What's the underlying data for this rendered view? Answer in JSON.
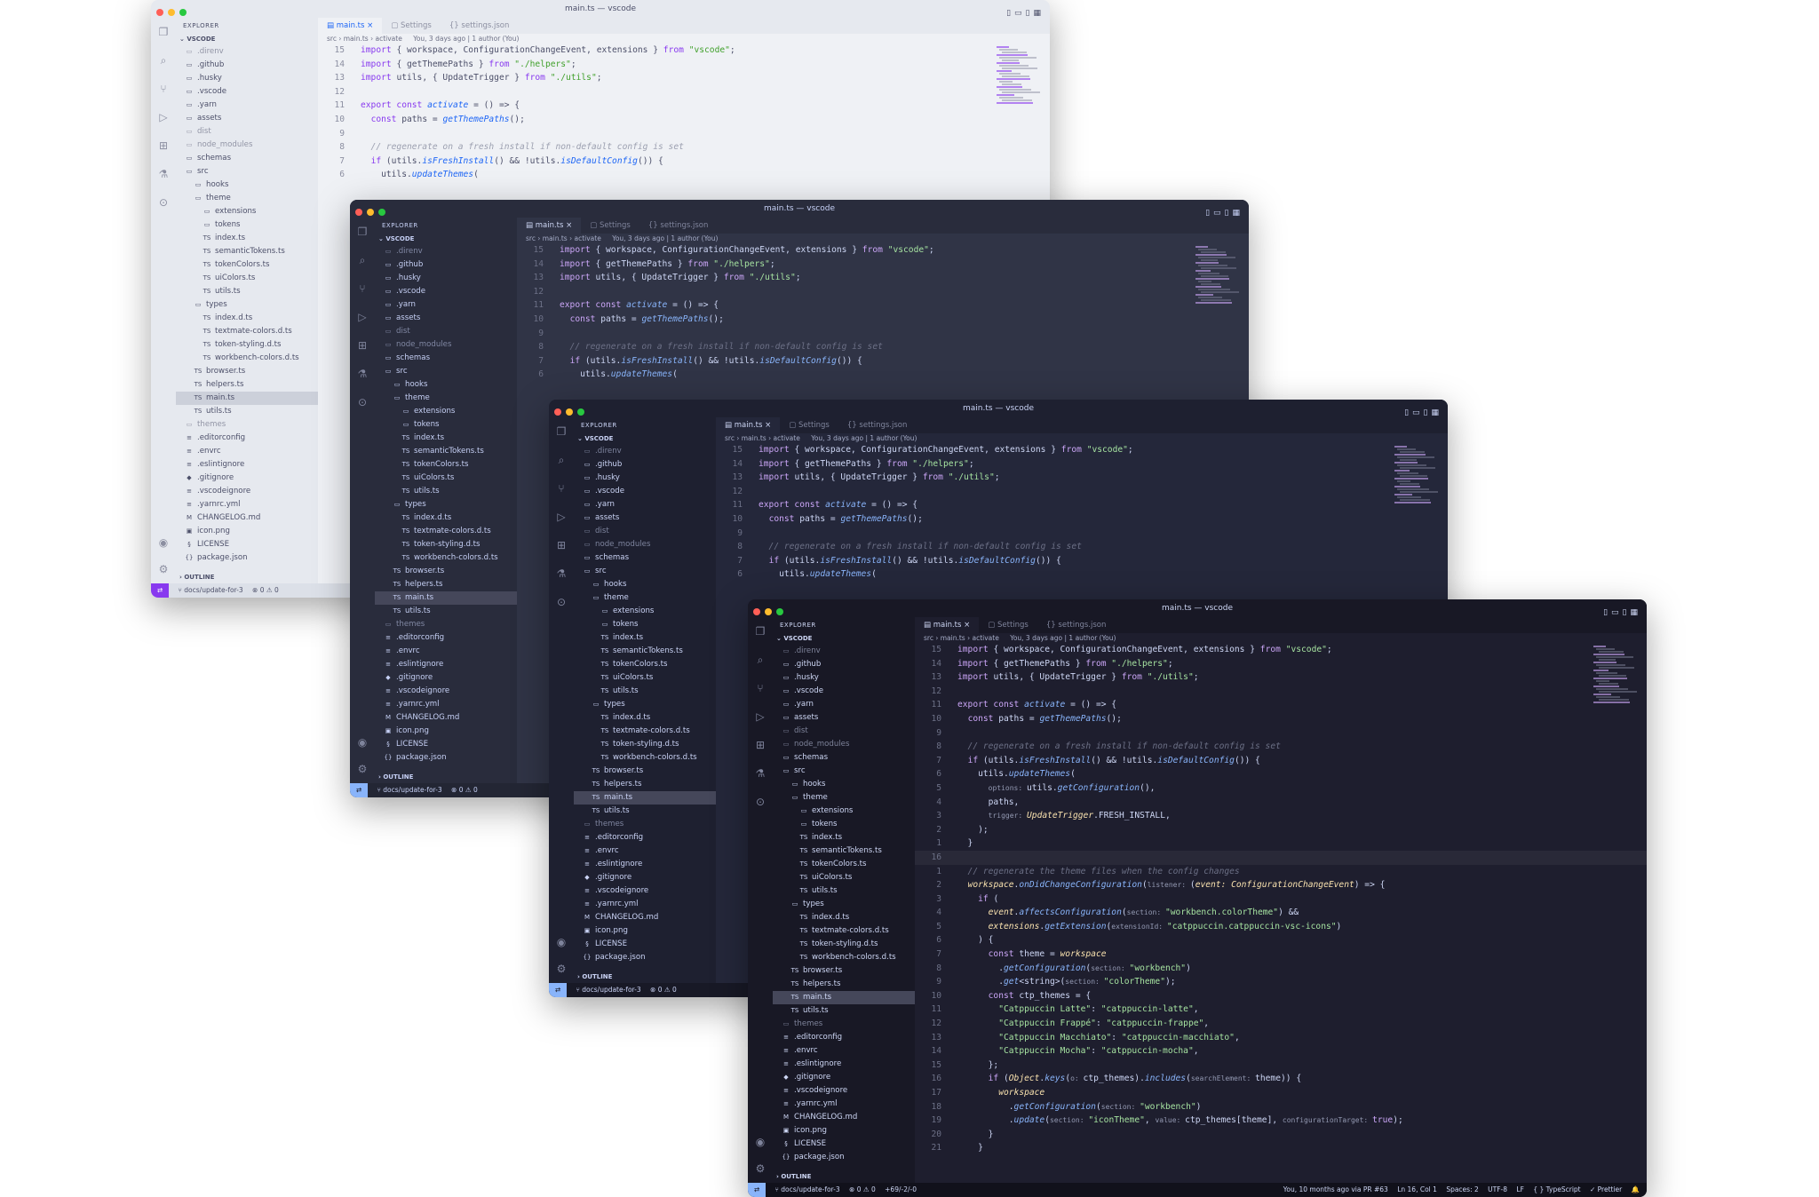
{
  "window_title": "main.ts — vscode",
  "explorer_label": "EXPLORER",
  "root_label": "VSCODE",
  "outline_label": "OUTLINE",
  "tabs": [
    {
      "label": "main.ts",
      "icon": "ts-file-icon",
      "active": true
    },
    {
      "label": "Settings",
      "icon": "settings-file-icon",
      "active": false
    },
    {
      "label": "settings.json",
      "icon": "json-file-icon",
      "active": false
    }
  ],
  "breadcrumb": {
    "seg1": "src",
    "seg2": "main.ts",
    "seg3": "activate"
  },
  "blame_inline": "You, 3 days ago | 1 author (You)",
  "files": [
    {
      "name": ".direnv",
      "depth": 0,
      "type": "folder",
      "dim": true
    },
    {
      "name": ".github",
      "depth": 0,
      "type": "folder"
    },
    {
      "name": ".husky",
      "depth": 0,
      "type": "folder"
    },
    {
      "name": ".vscode",
      "depth": 0,
      "type": "folder"
    },
    {
      "name": ".yarn",
      "depth": 0,
      "type": "folder"
    },
    {
      "name": "assets",
      "depth": 0,
      "type": "folder"
    },
    {
      "name": "dist",
      "depth": 0,
      "type": "folder",
      "dim": true
    },
    {
      "name": "node_modules",
      "depth": 0,
      "type": "folder",
      "dim": true
    },
    {
      "name": "schemas",
      "depth": 0,
      "type": "folder"
    },
    {
      "name": "src",
      "depth": 0,
      "type": "folder-open"
    },
    {
      "name": "hooks",
      "depth": 1,
      "type": "folder"
    },
    {
      "name": "theme",
      "depth": 1,
      "type": "folder-open"
    },
    {
      "name": "extensions",
      "depth": 2,
      "type": "folder"
    },
    {
      "name": "tokens",
      "depth": 2,
      "type": "folder"
    },
    {
      "name": "index.ts",
      "depth": 2,
      "type": "ts"
    },
    {
      "name": "semanticTokens.ts",
      "depth": 2,
      "type": "ts"
    },
    {
      "name": "tokenColors.ts",
      "depth": 2,
      "type": "ts"
    },
    {
      "name": "uiColors.ts",
      "depth": 2,
      "type": "ts"
    },
    {
      "name": "utils.ts",
      "depth": 2,
      "type": "ts"
    },
    {
      "name": "types",
      "depth": 1,
      "type": "folder-open"
    },
    {
      "name": "index.d.ts",
      "depth": 2,
      "type": "ts"
    },
    {
      "name": "textmate-colors.d.ts",
      "depth": 2,
      "type": "ts"
    },
    {
      "name": "token-styling.d.ts",
      "depth": 2,
      "type": "ts"
    },
    {
      "name": "workbench-colors.d.ts",
      "depth": 2,
      "type": "ts"
    },
    {
      "name": "browser.ts",
      "depth": 1,
      "type": "ts"
    },
    {
      "name": "helpers.ts",
      "depth": 1,
      "type": "ts"
    },
    {
      "name": "main.ts",
      "depth": 1,
      "type": "ts",
      "selected": true
    },
    {
      "name": "utils.ts",
      "depth": 1,
      "type": "ts"
    },
    {
      "name": "themes",
      "depth": 0,
      "type": "folder",
      "dim": true
    },
    {
      "name": ".editorconfig",
      "depth": 0,
      "type": "config"
    },
    {
      "name": ".envrc",
      "depth": 0,
      "type": "config"
    },
    {
      "name": ".eslintignore",
      "depth": 0,
      "type": "config"
    },
    {
      "name": ".gitignore",
      "depth": 0,
      "type": "git"
    },
    {
      "name": ".vscodeignore",
      "depth": 0,
      "type": "config"
    },
    {
      "name": ".yarnrc.yml",
      "depth": 0,
      "type": "config"
    },
    {
      "name": "CHANGELOG.md",
      "depth": 0,
      "type": "md"
    },
    {
      "name": "icon.png",
      "depth": 0,
      "type": "image"
    },
    {
      "name": "LICENSE",
      "depth": 0,
      "type": "license"
    },
    {
      "name": "package.json",
      "depth": 0,
      "type": "json"
    }
  ],
  "code_short": [
    {
      "n": "15",
      "t": [
        [
          "kw",
          "import "
        ],
        [
          "",
          "{ workspace, ConfigurationChangeEvent, extensions } "
        ],
        [
          "kw",
          "from "
        ],
        [
          "str",
          "\"vscode\""
        ],
        [
          "",
          ";"
        ]
      ]
    },
    {
      "n": "14",
      "t": [
        [
          "kw",
          "import "
        ],
        [
          "",
          "{ getThemePaths } "
        ],
        [
          "kw",
          "from "
        ],
        [
          "str",
          "\"./helpers\""
        ],
        [
          "",
          ";"
        ]
      ]
    },
    {
      "n": "13",
      "t": [
        [
          "kw",
          "import "
        ],
        [
          "",
          "utils, { UpdateTrigger } "
        ],
        [
          "kw",
          "from "
        ],
        [
          "str",
          "\"./utils\""
        ],
        [
          "",
          ";"
        ]
      ]
    },
    {
      "n": "12",
      "t": [
        [
          "",
          ""
        ]
      ]
    },
    {
      "n": "11",
      "t": [
        [
          "kw",
          "export const "
        ],
        [
          "fn",
          "activate"
        ],
        [
          "",
          " = () => {"
        ]
      ]
    },
    {
      "n": "10",
      "t": [
        [
          "",
          "  "
        ],
        [
          "kw",
          "const "
        ],
        [
          "",
          "paths = "
        ],
        [
          "fn",
          "getThemePaths"
        ],
        [
          "",
          "();"
        ]
      ]
    },
    {
      "n": "9",
      "t": [
        [
          "",
          ""
        ]
      ]
    },
    {
      "n": "8",
      "t": [
        [
          "cm",
          "  // regenerate on a fresh install if non-default config is set"
        ]
      ]
    },
    {
      "n": "7",
      "t": [
        [
          "",
          "  "
        ],
        [
          "kw",
          "if "
        ],
        [
          "",
          "(utils."
        ],
        [
          "fn",
          "isFreshInstall"
        ],
        [
          "",
          "() && !utils."
        ],
        [
          "fn",
          "isDefaultConfig"
        ],
        [
          "",
          "()) {"
        ]
      ]
    },
    {
      "n": "6",
      "t": [
        [
          "",
          "    utils."
        ],
        [
          "fn",
          "updateThemes"
        ],
        [
          "",
          "("
        ]
      ]
    }
  ],
  "code_long": [
    {
      "n": "15",
      "t": [
        [
          "kw",
          "import "
        ],
        [
          "",
          "{ workspace, ConfigurationChangeEvent, extensions } "
        ],
        [
          "kw",
          "from "
        ],
        [
          "str",
          "\"vscode\""
        ],
        [
          "",
          ";"
        ]
      ]
    },
    {
      "n": "14",
      "t": [
        [
          "kw",
          "import "
        ],
        [
          "",
          "{ getThemePaths } "
        ],
        [
          "kw",
          "from "
        ],
        [
          "str",
          "\"./helpers\""
        ],
        [
          "",
          ";"
        ]
      ]
    },
    {
      "n": "13",
      "t": [
        [
          "kw",
          "import "
        ],
        [
          "",
          "utils, { UpdateTrigger } "
        ],
        [
          "kw",
          "from "
        ],
        [
          "str",
          "\"./utils\""
        ],
        [
          "",
          ";"
        ]
      ]
    },
    {
      "n": "12",
      "t": [
        [
          "",
          ""
        ]
      ]
    },
    {
      "n": "11",
      "t": [
        [
          "kw",
          "export const "
        ],
        [
          "fn",
          "activate"
        ],
        [
          "",
          " = () => {"
        ]
      ]
    },
    {
      "n": "10",
      "t": [
        [
          "",
          "  "
        ],
        [
          "kw",
          "const "
        ],
        [
          "",
          "paths = "
        ],
        [
          "fn",
          "getThemePaths"
        ],
        [
          "",
          "();"
        ]
      ]
    },
    {
      "n": "9",
      "t": [
        [
          "",
          ""
        ]
      ]
    },
    {
      "n": "8",
      "t": [
        [
          "cm",
          "  // regenerate on a fresh install if non-default config is set"
        ]
      ]
    },
    {
      "n": "7",
      "t": [
        [
          "",
          "  "
        ],
        [
          "kw",
          "if "
        ],
        [
          "",
          "(utils."
        ],
        [
          "fn",
          "isFreshInstall"
        ],
        [
          "",
          "() && !utils."
        ],
        [
          "fn",
          "isDefaultConfig"
        ],
        [
          "",
          "()) {"
        ]
      ]
    },
    {
      "n": "6",
      "t": [
        [
          "",
          "    utils."
        ],
        [
          "fn",
          "updateThemes"
        ],
        [
          "",
          "("
        ]
      ]
    },
    {
      "n": "5",
      "t": [
        [
          "",
          "      "
        ],
        [
          "hint",
          "options: "
        ],
        [
          "",
          "utils."
        ],
        [
          "fn",
          "getConfiguration"
        ],
        [
          "",
          "(),"
        ]
      ]
    },
    {
      "n": "4",
      "t": [
        [
          "",
          "      paths,"
        ]
      ]
    },
    {
      "n": "3",
      "t": [
        [
          "",
          "      "
        ],
        [
          "hint",
          "trigger: "
        ],
        [
          "ty",
          "UpdateTrigger"
        ],
        [
          "",
          ".FRESH_INSTALL,"
        ]
      ]
    },
    {
      "n": "2",
      "t": [
        [
          "",
          "    );"
        ]
      ]
    },
    {
      "n": "1",
      "t": [
        [
          "",
          "  }"
        ]
      ]
    },
    {
      "n": "16",
      "t": [
        [
          "",
          ""
        ]
      ],
      "current": true
    },
    {
      "n": "1",
      "t": [
        [
          "cm",
          "  // regenerate the theme files when the config changes"
        ]
      ]
    },
    {
      "n": "2",
      "t": [
        [
          "",
          "  "
        ],
        [
          "ty",
          "workspace"
        ],
        [
          "",
          "."
        ],
        [
          "fn",
          "onDidChangeConfiguration"
        ],
        [
          "",
          "("
        ],
        [
          "hint",
          "listener: "
        ],
        [
          "",
          "("
        ],
        [
          "ty",
          "event: ConfigurationChangeEvent"
        ],
        [
          "",
          ") => {"
        ]
      ]
    },
    {
      "n": "3",
      "t": [
        [
          "",
          "    "
        ],
        [
          "kw",
          "if "
        ],
        [
          "",
          "("
        ]
      ]
    },
    {
      "n": "4",
      "t": [
        [
          "",
          "      "
        ],
        [
          "ty",
          "event"
        ],
        [
          "",
          "."
        ],
        [
          "fn",
          "affectsConfiguration"
        ],
        [
          "",
          "("
        ],
        [
          "hint",
          "section: "
        ],
        [
          "str",
          "\"workbench.colorTheme\""
        ],
        [
          "",
          ") &&"
        ]
      ]
    },
    {
      "n": "5",
      "t": [
        [
          "",
          "      "
        ],
        [
          "ty",
          "extensions"
        ],
        [
          "",
          "."
        ],
        [
          "fn",
          "getExtension"
        ],
        [
          "",
          "("
        ],
        [
          "hint",
          "extensionId: "
        ],
        [
          "str",
          "\"catppuccin.catppuccin-vsc-icons\""
        ],
        [
          "",
          ")"
        ]
      ]
    },
    {
      "n": "6",
      "t": [
        [
          "",
          "    ) {"
        ]
      ]
    },
    {
      "n": "7",
      "t": [
        [
          "",
          "      "
        ],
        [
          "kw",
          "const "
        ],
        [
          "",
          "theme = "
        ],
        [
          "ty",
          "workspace"
        ]
      ]
    },
    {
      "n": "8",
      "t": [
        [
          "",
          "        ."
        ],
        [
          "fn",
          "getConfiguration"
        ],
        [
          "",
          "("
        ],
        [
          "hint",
          "section: "
        ],
        [
          "str",
          "\"workbench\""
        ],
        [
          "",
          ")"
        ]
      ]
    },
    {
      "n": "9",
      "t": [
        [
          "",
          "        ."
        ],
        [
          "fn",
          "get"
        ],
        [
          "",
          "<string>("
        ],
        [
          "hint",
          "section: "
        ],
        [
          "str",
          "\"colorTheme\""
        ],
        [
          "",
          ");"
        ]
      ]
    },
    {
      "n": "10",
      "t": [
        [
          "",
          "      "
        ],
        [
          "kw",
          "const "
        ],
        [
          "",
          "ctp_themes = {"
        ]
      ]
    },
    {
      "n": "11",
      "t": [
        [
          "",
          "        "
        ],
        [
          "str",
          "\"Catppuccin Latte\""
        ],
        [
          "",
          ": "
        ],
        [
          "str",
          "\"catppuccin-latte\""
        ],
        [
          "",
          ","
        ]
      ]
    },
    {
      "n": "12",
      "t": [
        [
          "",
          "        "
        ],
        [
          "str",
          "\"Catppuccin Frappé\""
        ],
        [
          "",
          ": "
        ],
        [
          "str",
          "\"catppuccin-frappe\""
        ],
        [
          "",
          ","
        ]
      ]
    },
    {
      "n": "13",
      "t": [
        [
          "",
          "        "
        ],
        [
          "str",
          "\"Catppuccin Macchiato\""
        ],
        [
          "",
          ": "
        ],
        [
          "str",
          "\"catppuccin-macchiato\""
        ],
        [
          "",
          ","
        ]
      ]
    },
    {
      "n": "14",
      "t": [
        [
          "",
          "        "
        ],
        [
          "str",
          "\"Catppuccin Mocha\""
        ],
        [
          "",
          ": "
        ],
        [
          "str",
          "\"catppuccin-mocha\""
        ],
        [
          "",
          ","
        ]
      ]
    },
    {
      "n": "15",
      "t": [
        [
          "",
          "      };"
        ]
      ]
    },
    {
      "n": "16",
      "t": [
        [
          "",
          "      "
        ],
        [
          "kw",
          "if "
        ],
        [
          "",
          "("
        ],
        [
          "ty",
          "Object"
        ],
        [
          "",
          "."
        ],
        [
          "fn",
          "keys"
        ],
        [
          "",
          "("
        ],
        [
          "hint",
          "o: "
        ],
        [
          "",
          "ctp_themes)."
        ],
        [
          "fn",
          "includes"
        ],
        [
          "",
          "("
        ],
        [
          "hint",
          "searchElement: "
        ],
        [
          "",
          "theme)) {"
        ]
      ]
    },
    {
      "n": "17",
      "t": [
        [
          "",
          "        "
        ],
        [
          "ty",
          "workspace"
        ]
      ]
    },
    {
      "n": "18",
      "t": [
        [
          "",
          "          ."
        ],
        [
          "fn",
          "getConfiguration"
        ],
        [
          "",
          "("
        ],
        [
          "hint",
          "section: "
        ],
        [
          "str",
          "\"workbench\""
        ],
        [
          "",
          ")"
        ]
      ]
    },
    {
      "n": "19",
      "t": [
        [
          "",
          "          ."
        ],
        [
          "fn",
          "update"
        ],
        [
          "",
          "("
        ],
        [
          "hint",
          "section: "
        ],
        [
          "str",
          "\"iconTheme\""
        ],
        [
          "",
          ", "
        ],
        [
          "hint",
          "value: "
        ],
        [
          "",
          "ctp_themes[theme], "
        ],
        [
          "hint",
          "configurationTarget: "
        ],
        [
          "kw",
          "true"
        ],
        [
          "",
          ");"
        ]
      ]
    },
    {
      "n": "20",
      "t": [
        [
          "",
          "      }"
        ]
      ]
    },
    {
      "n": "21",
      "t": [
        [
          "",
          "    }"
        ]
      ]
    }
  ],
  "status": {
    "branch": "docs/update-for-3",
    "problems": "⊗ 0 ⚠ 0",
    "diff": "+69/-2/-0",
    "blame": "You, 10 months ago via PR #63",
    "position": "Ln 16, Col 1",
    "spaces": "Spaces: 2",
    "encoding": "UTF-8",
    "eol": "LF",
    "language": "{ } TypeScript",
    "formatter": "✓ Prettier"
  },
  "colors": {
    "latte_accent": "#1e66f5",
    "frappe_bg": "#303446",
    "macchiato_bg": "#24273a",
    "mocha_bg": "#1e1e2e"
  },
  "activity_icons": [
    "files-icon",
    "search-icon",
    "source-control-icon",
    "run-debug-icon",
    "extensions-icon",
    "testing-icon",
    "remote-icon"
  ]
}
